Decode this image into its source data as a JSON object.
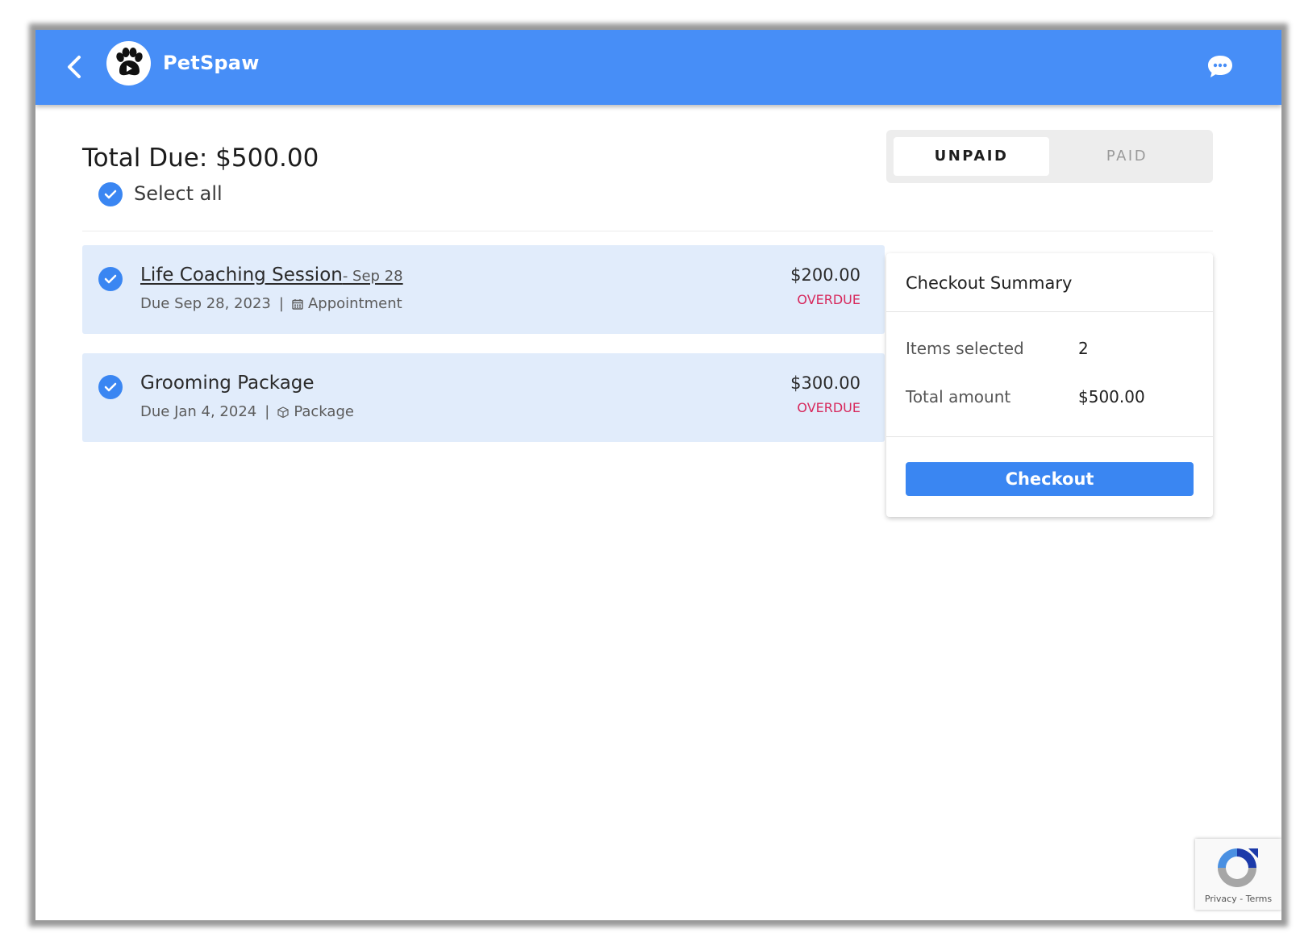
{
  "header": {
    "title": "PetSpaw",
    "brand_color": "#478ef7",
    "back_icon": "chevron-left-icon",
    "logo_icon": "paw-icon",
    "chat_icon": "chat-bubble-icon"
  },
  "summary_header": {
    "total_due_label": "Total Due:",
    "total_due_value": "$500.00",
    "select_all_label": "Select all"
  },
  "tabs": [
    {
      "label": "UNPAID",
      "active": true
    },
    {
      "label": "PAID",
      "active": false
    }
  ],
  "invoices": [
    {
      "title": "Life Coaching Session",
      "title_date": "- Sep 28",
      "due": "Due Sep 28, 2023",
      "separator": "|",
      "type": "Appointment",
      "type_icon": "calendar-icon",
      "amount": "$200.00",
      "status": "OVERDUE",
      "selected": true
    },
    {
      "title": "Grooming Package",
      "title_date": "",
      "due": "Due Jan 4, 2024",
      "separator": "|",
      "type": "Package",
      "type_icon": "box-icon",
      "amount": "$300.00",
      "status": "OVERDUE",
      "selected": true
    }
  ],
  "checkout_summary": {
    "title": "Checkout Summary",
    "items_selected_label": "Items selected",
    "items_selected_value": "2",
    "total_amount_label": "Total amount",
    "total_amount_value": "$500.00",
    "button_label": "Checkout"
  },
  "recaptcha": {
    "links": "Privacy - Terms"
  },
  "colors": {
    "accent": "#3a86f2",
    "card_bg": "#e1ecfb",
    "overdue": "#d7285c"
  }
}
